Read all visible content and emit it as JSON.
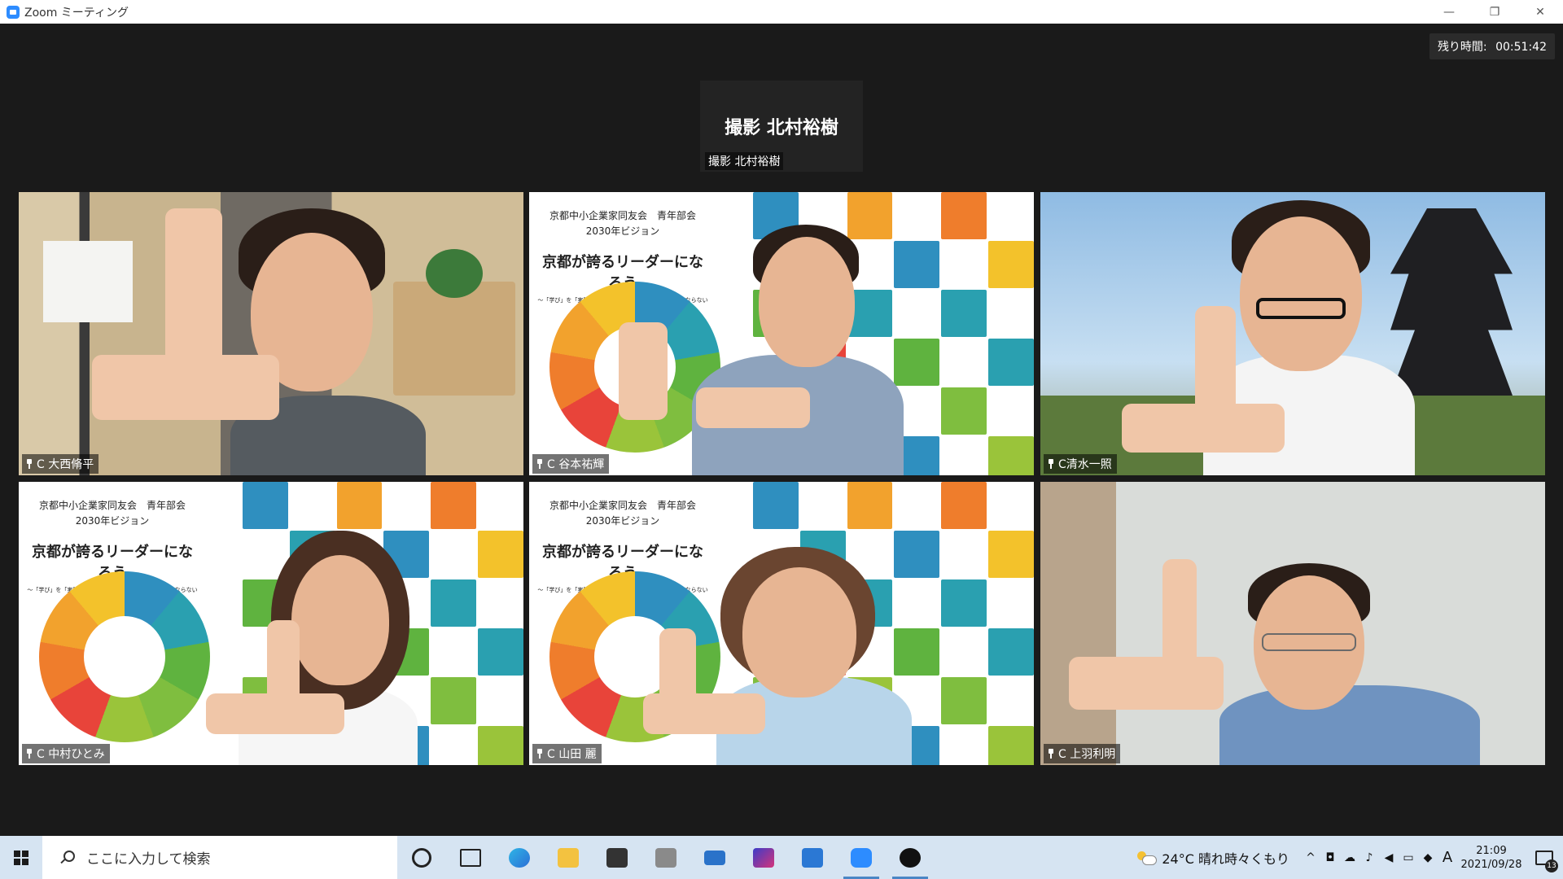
{
  "window": {
    "title": "Zoom ミーティング",
    "controls": {
      "minimize": "—",
      "restore": "❐",
      "close": "✕"
    }
  },
  "meeting": {
    "timer_label": "残り時間:",
    "timer_value": "00:51:42",
    "active_speaker": {
      "big_label": "撮影 北村裕樹",
      "name": "撮影 北村裕樹"
    },
    "participants": [
      {
        "name": "C 大西脩平"
      },
      {
        "name": "C 谷本祐輝"
      },
      {
        "name": "C清水一照"
      },
      {
        "name": "C 中村ひとみ"
      },
      {
        "name": "C 山田 麗"
      },
      {
        "name": "C 上羽利明"
      }
    ],
    "vision_slide": {
      "org": "京都中小企業家同友会　青年部会",
      "sub": "2030年ビジョン",
      "headline": "京都が誇るリーダーになろう",
      "tagline": "〜「学び」を「実践」し「成果」に繋げ、地域になくてはならない経営者へ〜"
    }
  },
  "taskbar": {
    "search_placeholder": "ここに入力して検索",
    "weather": "24°C  晴れ時々くもり",
    "time": "21:09",
    "date": "2021/09/28",
    "ime": "A",
    "notification_count": "13"
  },
  "colors": {
    "stage_bg": "#1a1a1a",
    "taskbar_bg": "#d6e4f2",
    "zoom_blue": "#2d8cff"
  }
}
